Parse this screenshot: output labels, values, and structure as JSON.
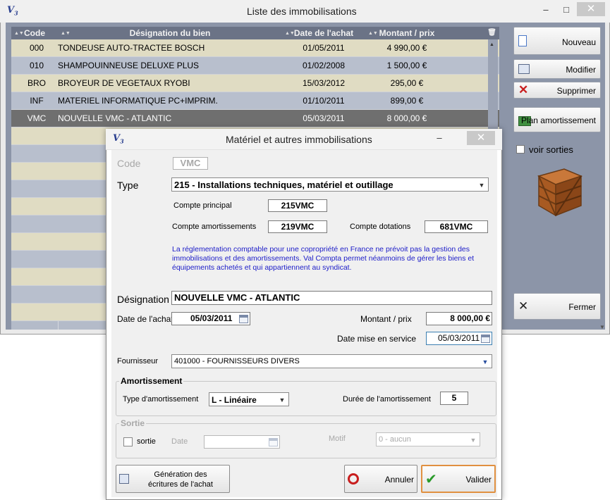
{
  "main_window": {
    "title": "Liste des immobilisations",
    "minimize": "–",
    "maximize": "□",
    "close": "✕"
  },
  "grid": {
    "columns": [
      "Code",
      "Désignation du bien",
      "Date de l'achat",
      "Montant / prix"
    ],
    "rows": [
      {
        "code": "000",
        "designation": "TONDEUSE AUTO-TRACTEE BOSCH",
        "date": "01/05/2011",
        "montant": "4 990,00 €"
      },
      {
        "code": "010",
        "designation": "SHAMPOUINNEUSE DELUXE PLUS",
        "date": "01/02/2008",
        "montant": "1 500,00 €"
      },
      {
        "code": "BRO",
        "designation": "BROYEUR DE VEGETAUX RYOBI",
        "date": "15/03/2012",
        "montant": "295,00 €"
      },
      {
        "code": "INF",
        "designation": "MATERIEL INFORMATIQUE PC+IMPRIM.",
        "date": "01/10/2011",
        "montant": "899,00 €"
      },
      {
        "code": "VMC",
        "designation": "NOUVELLE VMC - ATLANTIC",
        "date": "05/03/2011",
        "montant": "8 000,00 €"
      }
    ]
  },
  "side_buttons": {
    "nouveau": "Nouveau",
    "modifier": "Modifier",
    "supprimer": "Supprimer",
    "plan": "Plan amortissement",
    "voir_sorties": "voir sorties",
    "fermer": "Fermer"
  },
  "dialog": {
    "title": "Matériel et autres immobilisations",
    "minimize": "–",
    "close": "✕",
    "code_label": "Code",
    "code_value": "VMC",
    "type_label": "Type",
    "type_value": "215 - Installations techniques, matériel et outillage",
    "compte_principal_label": "Compte principal",
    "compte_principal_value": "215VMC",
    "compte_amort_label": "Compte amortissements",
    "compte_amort_value": "219VMC",
    "compte_dot_label": "Compte dotations",
    "compte_dot_value": "681VMC",
    "info_text": "La réglementation comptable pour une copropriété en France ne prévoit pas la gestion des immobilisations et des amortissements. Val Compta permet néanmoins de gérer les biens et équipements achetés et qui appartiennent au syndicat.",
    "designation_label": "Désignation",
    "designation_value": "NOUVELLE VMC - ATLANTIC",
    "date_achat_label": "Date de l'achat",
    "date_achat_value": "05/03/2011",
    "montant_label": "Montant / prix",
    "montant_value": "8 000,00 €",
    "date_service_label": "Date mise en service",
    "date_service_value": "05/03/2011",
    "fournisseur_label": "Fournisseur",
    "fournisseur_value": "401000 - FOURNISSEURS DIVERS",
    "amort_group": "Amortissement",
    "type_amort_label": "Type d'amortissement",
    "type_amort_value": "L - Linéaire",
    "duree_label": "Durée de l'amortissement",
    "duree_value": "5",
    "sortie_group": "Sortie",
    "sortie_check_label": "sortie",
    "sortie_date_label": "Date",
    "motif_label": "Motif",
    "motif_value": "0 - aucun",
    "generation_label_1": "Génération des",
    "generation_label_2": "écritures de l'achat",
    "annuler": "Annuler",
    "valider": "Valider"
  },
  "colors": {
    "grid_header": "#6b7386",
    "row_odd": "#e0dcc3",
    "row_even": "#b8bfcd",
    "row_selected": "#6f6f6f",
    "info_text": "#1c1cc8",
    "client_bg": "#8c95a8"
  }
}
